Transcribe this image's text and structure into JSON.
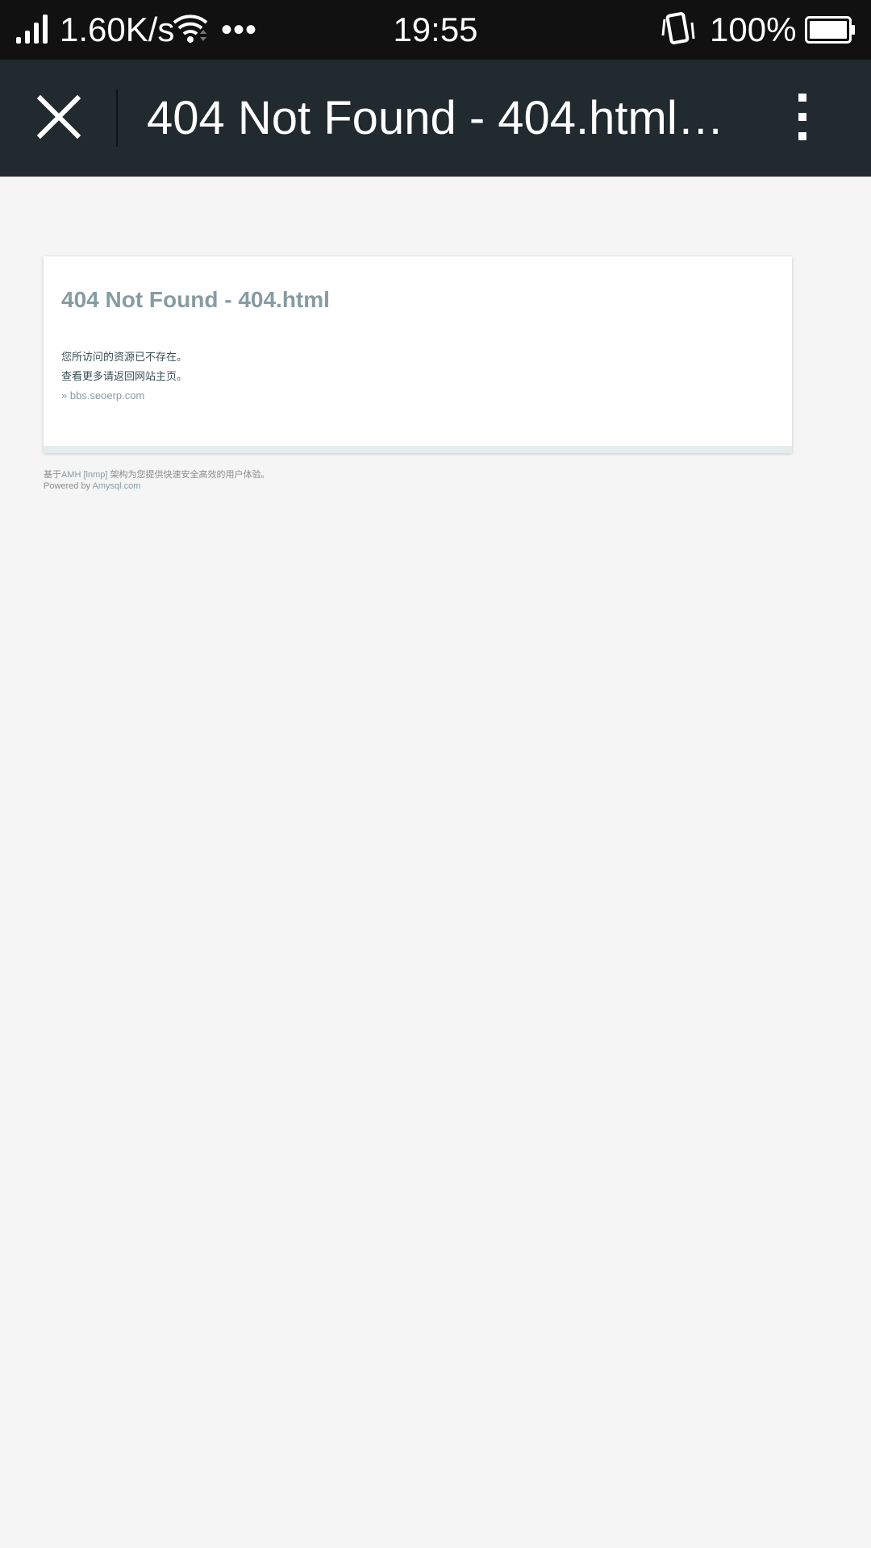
{
  "statusbar": {
    "net_speed": "1.60K/s",
    "more": "•••",
    "time": "19:55",
    "battery_percent": "100%",
    "battery_level": 1.0
  },
  "toolbar": {
    "title": "404 Not Found - 404.html -..."
  },
  "page": {
    "heading": "404 Not Found - 404.html",
    "line1": "您所访问的资源已不存在。",
    "line2": "查看更多请返回网站主页。",
    "link_prefix": "» ",
    "link_text": "bbs.seoerp.com",
    "footer_prefix": "基于",
    "footer_link1": "AMH [lnmp]",
    "footer_suffix": " 架构为您提供快速安全高效的用户体验。",
    "powered_prefix": "Powered by ",
    "powered_link": "Amysql.com"
  },
  "colors": {
    "statusbar_bg": "#111111",
    "toolbar_bg": "#212a2e",
    "page_bg": "#f5f5f5",
    "accent": "#869ca3"
  },
  "icons": [
    "signal-icon",
    "wifi-icon",
    "vibrate-icon",
    "battery-icon",
    "close-icon",
    "more-vert-icon"
  ]
}
